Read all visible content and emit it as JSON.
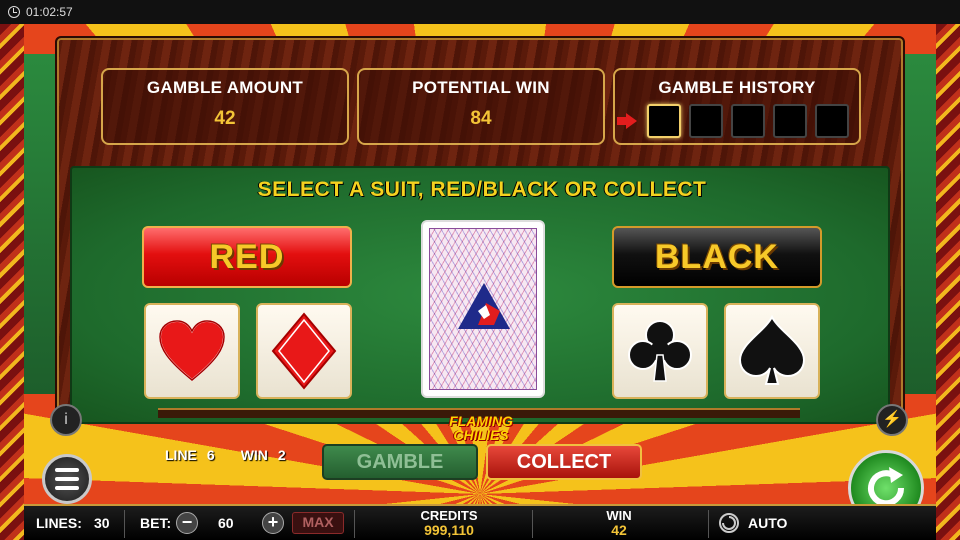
{
  "status_bar": {
    "time": "01:02:57",
    "icon": "clock-icon"
  },
  "info": {
    "gamble_amount_label": "GAMBLE AMOUNT",
    "gamble_amount_value": "42",
    "potential_win_label": "POTENTIAL WIN",
    "potential_win_value": "84",
    "gamble_history_label": "GAMBLE HISTORY",
    "history_slots": 5
  },
  "felt": {
    "prompt": "SELECT A SUIT, RED/BLACK OR COLLECT",
    "red_label": "RED",
    "black_label": "BLACK",
    "suits": [
      "heart",
      "diamond",
      "club",
      "spade"
    ]
  },
  "hud": {
    "logo_line1": "FLAMING",
    "logo_line2": "CHILIES",
    "line_label": "LINE",
    "line_value": "6",
    "win_label": "WIN",
    "win_value": "2",
    "gamble_label": "GAMBLE",
    "collect_label": "COLLECT"
  },
  "bottom_bar": {
    "lines_label": "LINES:",
    "lines_value": "30",
    "bet_label": "BET:",
    "bet_value": "60",
    "max_label": "MAX",
    "credits_label": "CREDITS",
    "credits_value": "999,110",
    "win_label": "WIN",
    "win_value": "42",
    "auto_label": "AUTO"
  },
  "colors": {
    "gold": "#f3c437",
    "felt": "#1e6a2c",
    "red": "#e30f0f",
    "black": "#000000"
  }
}
